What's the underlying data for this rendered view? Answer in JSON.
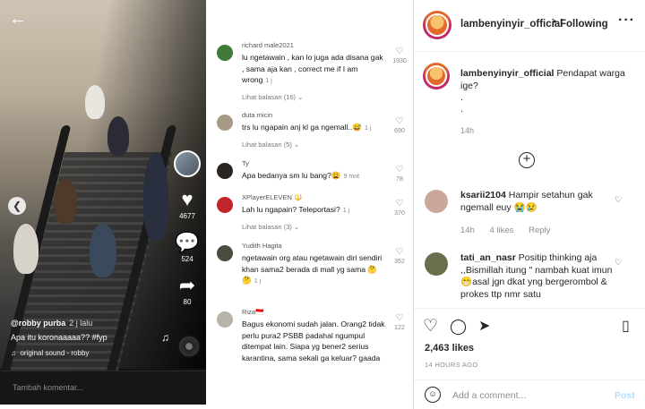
{
  "video": {
    "back_icon": "back-arrow-icon",
    "username": "@robby purba",
    "posted": "2 j lalu",
    "caption": "Apa itu koronaaaaa?? #fyp",
    "sound": "original sound - robby",
    "likes": "4677",
    "comments": "524",
    "shares": "80",
    "comment_placeholder": "Tambah komentar..."
  },
  "comments": [
    {
      "name": "richard male2021",
      "text": "lu ngetawain , kan lo juga ada disana gak , sama aja kan , correct me if I am wrong",
      "time": "1 j",
      "replies": "Lihat balasan (16)",
      "likes": "1930",
      "avatar_color": "#3f7a3a"
    },
    {
      "name": "duta micin",
      "text": "trs lu ngapain anj kl ga ngemall..😅",
      "time": "1 j",
      "replies": "Lihat balasan (5)",
      "likes": "690",
      "avatar_color": "#a79a86"
    },
    {
      "name": "Ty",
      "text": "Apa bedanya sm lu bang?😩",
      "time": "9 mnt",
      "replies": "",
      "likes": "78",
      "avatar_color": "#2c2423"
    },
    {
      "name": "XPlayerELEVEN 🔱",
      "text": "Lah lu ngapain? Teleportasi?",
      "time": "1 j",
      "replies": "Lihat balasan (3)",
      "likes": "370",
      "avatar_color": "#c2262a"
    },
    {
      "name": "Yudith Hagita",
      "text": "ngetawain org atau ngetawain diri sendiri khan sama2 berada di mall yg sama 🤔🤔",
      "time": "1 j",
      "replies": "",
      "likes": "352",
      "avatar_color": "#4b4b3f"
    },
    {
      "name": "Riza🇮🇩",
      "text": "Bagus ekonomi sudah jalan. Orang2 tidak perlu pura2 PSBB padahal ngumpul ditempat lain. Siapa yg bener2 serius karantina, sama sekali ga keluar? gaada",
      "time": "1 j",
      "replies": "",
      "likes": "122",
      "avatar_color": "#b9b3ab"
    }
  ],
  "ig": {
    "username": "lambenyinyir_official",
    "dot": "•",
    "following": "Following",
    "caption_user": "lambenyinyir_official",
    "caption_text": "Pendapat warga ige?",
    "caption_dots": ".",
    "caption_dots2": ".",
    "caption_time": "14h",
    "comments": [
      {
        "user": "ksarii2104",
        "text": "Hampir setahun gak ngemall euy 😭😢",
        "time": "14h",
        "likes": "4 likes",
        "reply": "Reply",
        "avatar_color": "#c9a89a"
      },
      {
        "user": "tati_an_nasr",
        "text": "Positip thinking aja ,,Bismillah itung \" nambah kuat imun 😁asal jgn dkat yng bergerombol & prokes ttp nmr satu",
        "time": "",
        "likes": "",
        "reply": "",
        "avatar_color": "#6a6e4c"
      }
    ],
    "like_count": "2,463 likes",
    "time_ago": "14 HOURS AGO",
    "add_comment_placeholder": "Add a comment...",
    "post_label": "Post"
  }
}
